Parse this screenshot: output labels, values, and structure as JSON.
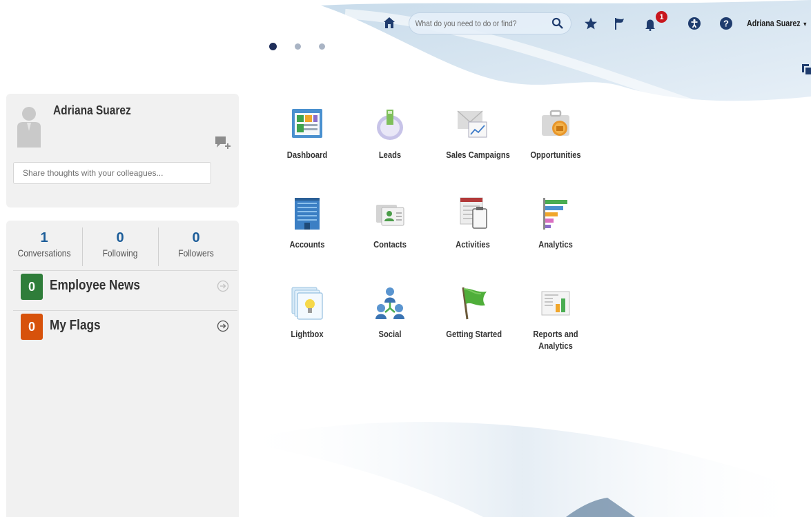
{
  "header": {
    "search_placeholder": "What do you need to do or find?",
    "user_name": "Adriana Suarez",
    "notification_count": "1",
    "icons": [
      "home-icon",
      "search-icon",
      "star-icon",
      "flag-icon",
      "bell-icon",
      "accessibility-icon",
      "help-icon",
      "chevron-down-icon"
    ]
  },
  "carousel": {
    "active_index": 0,
    "count": 3
  },
  "profile": {
    "name": "Adriana Suarez",
    "share_placeholder": "Share thoughts with your colleagues..."
  },
  "stats": [
    {
      "value": "1",
      "label": "Conversations"
    },
    {
      "value": "0",
      "label": "Following"
    },
    {
      "value": "0",
      "label": "Followers"
    }
  ],
  "feeds": [
    {
      "count": "0",
      "label": "Employee News",
      "color": "#2f7d3a"
    },
    {
      "count": "0",
      "label": "My Flags",
      "color": "#d7520b"
    }
  ],
  "apps": [
    {
      "label": "Dashboard",
      "icon": "dashboard-icon"
    },
    {
      "label": "Leads",
      "icon": "leads-icon"
    },
    {
      "label": "Sales Campaigns",
      "icon": "sales-campaigns-icon"
    },
    {
      "label": "Opportunities",
      "icon": "opportunities-icon"
    },
    {
      "label": "Accounts",
      "icon": "accounts-icon"
    },
    {
      "label": "Contacts",
      "icon": "contacts-icon"
    },
    {
      "label": "Activities",
      "icon": "activities-icon"
    },
    {
      "label": "Analytics",
      "icon": "analytics-icon"
    },
    {
      "label": "Lightbox",
      "icon": "lightbox-icon"
    },
    {
      "label": "Social",
      "icon": "social-icon"
    },
    {
      "label": "Getting Started",
      "icon": "getting-started-icon"
    },
    {
      "label": "Reports and Analytics",
      "icon": "reports-and-analytics-icon"
    }
  ],
  "colors": {
    "accent_blue": "#1c5d99",
    "nav_dark": "#1f2e5a",
    "badge_red": "#c8161d"
  }
}
